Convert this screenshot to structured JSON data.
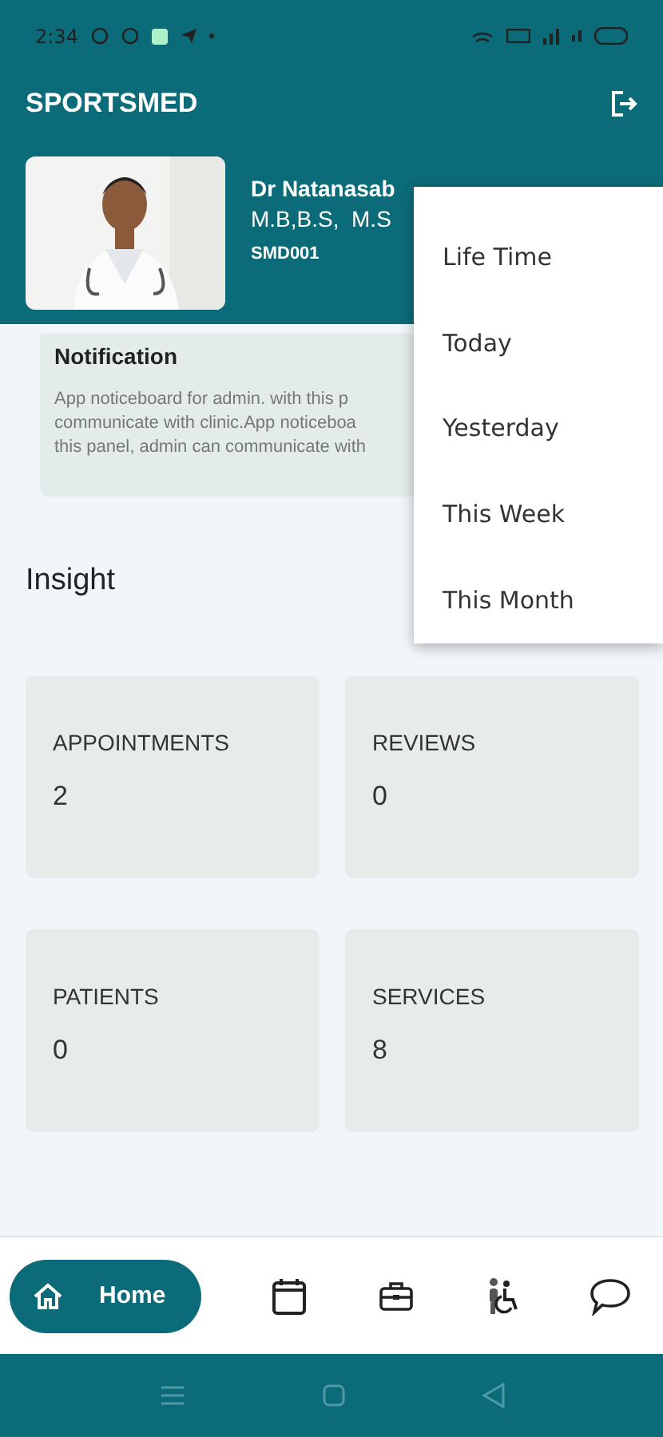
{
  "status_bar": {
    "time": "2:34"
  },
  "app_bar": {
    "title": "SPORTSMED"
  },
  "profile": {
    "name": "Dr Natanasab",
    "degrees": "M.B,B.S,  M.S",
    "code": "SMD001"
  },
  "notification": {
    "title": "Notification",
    "lines": [
      "App noticeboard for admin. with this p",
      "communicate with clinic.App noticeboa",
      "this panel, admin can communicate with"
    ]
  },
  "insight": {
    "title": "Insight"
  },
  "stats": [
    {
      "label": "APPOINTMENTS",
      "value": "2"
    },
    {
      "label": "REVIEWS",
      "value": "0"
    },
    {
      "label": "PATIENTS",
      "value": "0"
    },
    {
      "label": "SERVICES",
      "value": "8"
    }
  ],
  "menu": [
    {
      "label": "Life Time"
    },
    {
      "label": "Today"
    },
    {
      "label": "Yesterday"
    },
    {
      "label": "This Week"
    },
    {
      "label": "This Month"
    }
  ],
  "bottom_nav": [
    {
      "kind": "home",
      "label": "Home",
      "selected": true
    },
    {
      "kind": "calendar",
      "selected": false
    },
    {
      "kind": "briefcase",
      "selected": false
    },
    {
      "kind": "wheelchair",
      "selected": false
    },
    {
      "kind": "chat",
      "selected": false
    }
  ]
}
